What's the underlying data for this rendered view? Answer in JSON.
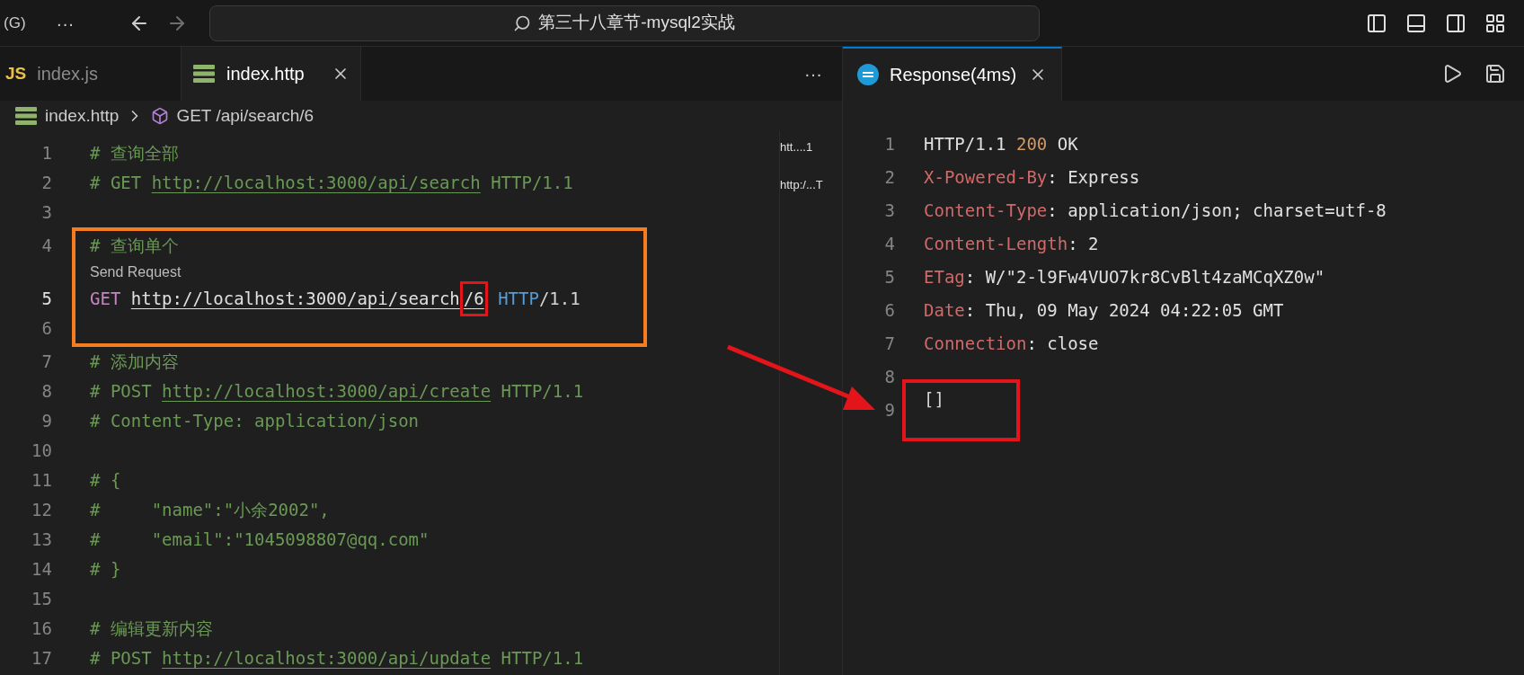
{
  "title_bar": {
    "account": "(G)",
    "menu": "···",
    "search": "第三十八章节-mysql2实战"
  },
  "editor": {
    "tabs": [
      {
        "icon_text": "JS",
        "label": "index.js",
        "selected": false,
        "kind": "js"
      },
      {
        "label": "index.http",
        "selected": true,
        "kind": "http"
      }
    ],
    "more": "···",
    "breadcrumb": {
      "file": "index.http",
      "symbol": "GET /api/search/6"
    },
    "minimap": [
      "htt....1",
      "http:/...T"
    ],
    "lines": [
      {
        "number": "1",
        "tokens": [
          {
            "kind": "comment",
            "text": "# 查询全部"
          }
        ]
      },
      {
        "number": "2",
        "tokens": [
          {
            "kind": "comment",
            "text": "# GET "
          },
          {
            "kind": "comment_url",
            "text": "http://localhost:3000/api/search"
          },
          {
            "kind": "comment",
            "text": " HTTP/1.1"
          }
        ]
      },
      {
        "number": "3"
      },
      {
        "number": "4",
        "boxed": true,
        "tokens": [
          {
            "kind": "comment",
            "text": "# 查询单个"
          }
        ]
      },
      {
        "number": "5",
        "boxed": true,
        "current": true,
        "codelens": "Send Request",
        "tokens": [
          {
            "kind": "method",
            "text": "GET "
          },
          {
            "kind": "url",
            "text": "http://localhost:3000/api/search"
          },
          {
            "kind": "url_boxed",
            "text": "/6"
          },
          {
            "kind": "protocol",
            "text": " HTTP"
          },
          {
            "kind": "plain",
            "text": "/1.1"
          }
        ]
      },
      {
        "number": "6",
        "boxed": true
      },
      {
        "number": "7",
        "tokens": [
          {
            "kind": "comment",
            "text": "# 添加内容"
          }
        ]
      },
      {
        "number": "8",
        "tokens": [
          {
            "kind": "comment",
            "text": "# POST "
          },
          {
            "kind": "comment_url",
            "text": "http://localhost:3000/api/create"
          },
          {
            "kind": "comment",
            "text": " HTTP/1.1"
          }
        ]
      },
      {
        "number": "9",
        "tokens": [
          {
            "kind": "comment",
            "text": "# Content-Type: application/json"
          }
        ]
      },
      {
        "number": "10"
      },
      {
        "number": "11",
        "tokens": [
          {
            "kind": "comment",
            "text": "# {"
          }
        ]
      },
      {
        "number": "12",
        "tokens": [
          {
            "kind": "comment",
            "text": "#     \"name\":\"小余2002\","
          }
        ]
      },
      {
        "number": "13",
        "tokens": [
          {
            "kind": "comment",
            "text": "#     \"email\":\"1045098807@qq.com\""
          }
        ]
      },
      {
        "number": "14",
        "tokens": [
          {
            "kind": "comment",
            "text": "# }"
          }
        ]
      },
      {
        "number": "15"
      },
      {
        "number": "16",
        "tokens": [
          {
            "kind": "comment",
            "text": "# 编辑更新内容"
          }
        ]
      },
      {
        "number": "17",
        "tokens": [
          {
            "kind": "comment",
            "text": "# POST "
          },
          {
            "kind": "comment_url",
            "text": "http://localhost:3000/api/update"
          },
          {
            "kind": "comment",
            "text": " HTTP/1.1"
          }
        ]
      }
    ]
  },
  "response": {
    "tab": {
      "label": "Response(4ms)",
      "selected": true
    },
    "lines": [
      {
        "number": "1",
        "tokens": [
          {
            "kind": "value",
            "text": "HTTP/1.1 "
          },
          {
            "kind": "status",
            "text": "200"
          },
          {
            "kind": "value",
            "text": " OK"
          }
        ]
      },
      {
        "number": "2",
        "tokens": [
          {
            "kind": "key",
            "text": "X-Powered-By"
          },
          {
            "kind": "value",
            "text": ": Express"
          }
        ]
      },
      {
        "number": "3",
        "tokens": [
          {
            "kind": "key",
            "text": "Content-Type"
          },
          {
            "kind": "value",
            "text": ": application/json; charset=utf-8"
          }
        ]
      },
      {
        "number": "4",
        "tokens": [
          {
            "kind": "key",
            "text": "Content-Length"
          },
          {
            "kind": "value",
            "text": ": 2"
          }
        ]
      },
      {
        "number": "5",
        "tokens": [
          {
            "kind": "key",
            "text": "ETag"
          },
          {
            "kind": "value",
            "text": ": W/\"2-l9Fw4VUO7kr8CvBlt4zaMCqXZ0w\""
          }
        ]
      },
      {
        "number": "6",
        "tokens": [
          {
            "kind": "key",
            "text": "Date"
          },
          {
            "kind": "value",
            "text": ": Thu, 09 May 2024 04:22:05 GMT"
          }
        ]
      },
      {
        "number": "7",
        "tokens": [
          {
            "kind": "key",
            "text": "Connection"
          },
          {
            "kind": "value",
            "text": ": close"
          }
        ]
      },
      {
        "number": "8"
      },
      {
        "number": "9",
        "tokens": [
          {
            "kind": "body_boxed",
            "text": "[]"
          }
        ]
      }
    ]
  }
}
